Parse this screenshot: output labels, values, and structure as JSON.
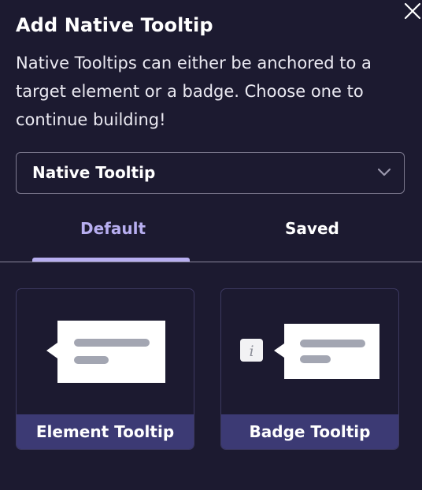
{
  "dialog": {
    "title": "Add Native Tooltip",
    "description": "Native Tooltips can either be anchored to a target element or a badge. Choose one to continue building!",
    "close_icon": "close-icon"
  },
  "select": {
    "value": "Native Tooltip",
    "icon": "chevron-down-icon"
  },
  "tabs": [
    {
      "label": "Default",
      "active": true
    },
    {
      "label": "Saved",
      "active": false
    }
  ],
  "cards": [
    {
      "label": "Element Tooltip",
      "preview": "element-tooltip-illustration"
    },
    {
      "label": "Badge Tooltip",
      "preview": "badge-tooltip-illustration",
      "badge_glyph": "i"
    }
  ],
  "colors": {
    "background": "#1c1a30",
    "accent": "#b7aef0",
    "card_footer": "#3c3a74",
    "border": "#7d7a8f"
  }
}
